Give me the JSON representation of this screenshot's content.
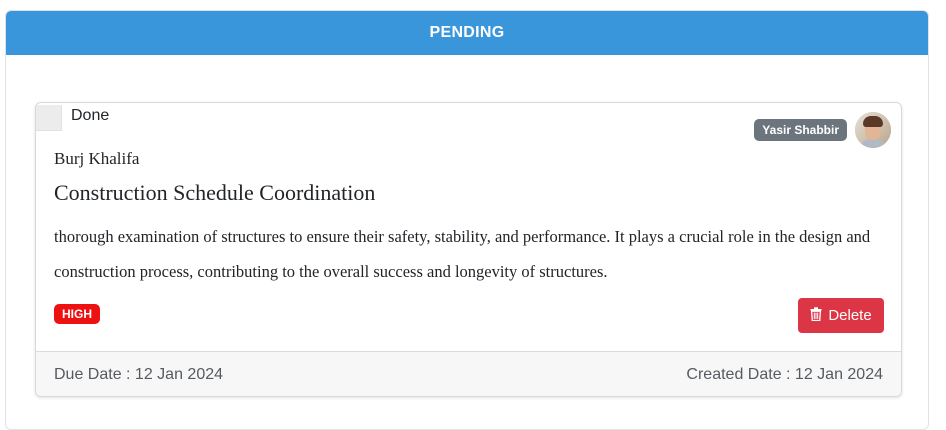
{
  "column": {
    "header": "PENDING"
  },
  "card": {
    "done_label": "Done",
    "assignee": "Yasir Shabbir",
    "project": "Burj Khalifa",
    "title": "Construction Schedule Coordination",
    "description": "thorough examination of structures to ensure their safety, stability, and performance. It plays a crucial role in the design and construction process, contributing to the overall success and longevity of structures.",
    "priority": "HIGH",
    "delete_label": "Delete",
    "due_date": "Due Date : 12 Jan 2024",
    "created_date": "Created Date : 12 Jan 2024"
  },
  "colors": {
    "header_bg": "#3a96db",
    "priority_high": "#ee1111",
    "delete_button": "#dc3545",
    "assignee_badge": "#6c757d"
  },
  "icons": {
    "delete": "trash-icon",
    "avatar": "user-avatar"
  }
}
